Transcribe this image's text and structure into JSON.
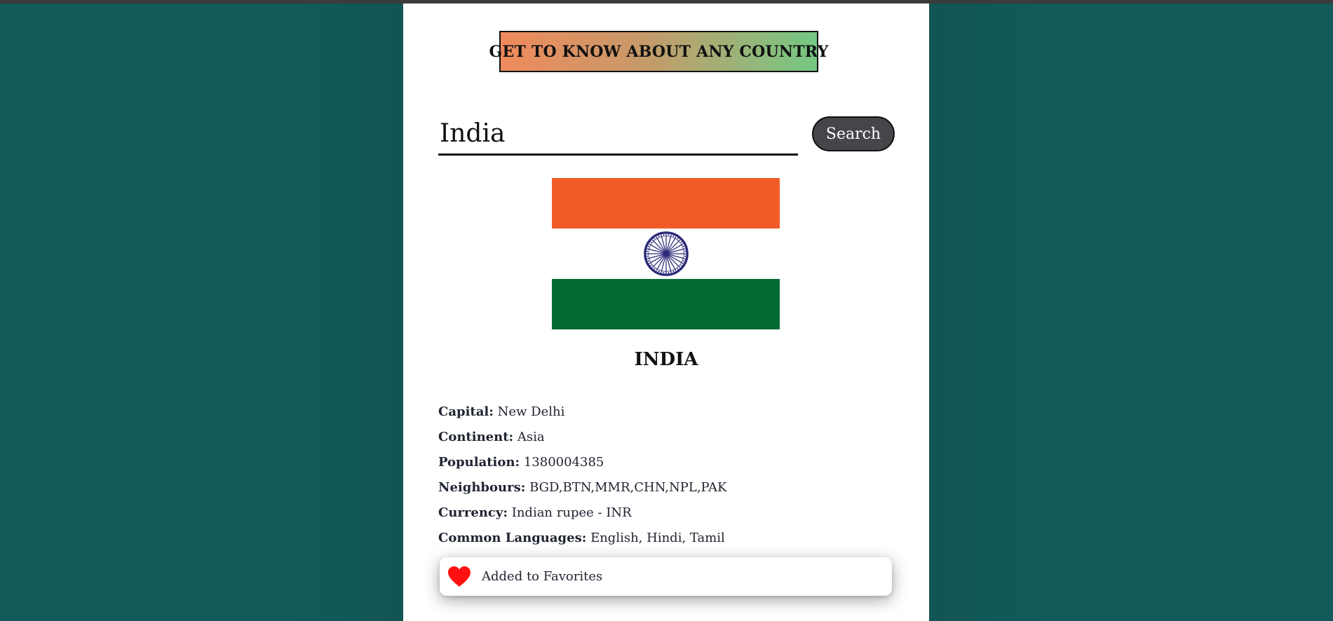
{
  "header": {
    "title": "GET TO KNOW ABOUT ANY COUNTRY"
  },
  "search": {
    "value": "India",
    "button_label": "Search"
  },
  "country": {
    "name": "INDIA",
    "flag_icon": "india-flag",
    "details": [
      {
        "label": "Capital:",
        "value": "New Delhi"
      },
      {
        "label": "Continent:",
        "value": "Asia"
      },
      {
        "label": "Population:",
        "value": "1380004385"
      },
      {
        "label": "Neighbours:",
        "value": "BGD,BTN,MMR,CHN,NPL,PAK"
      },
      {
        "label": "Currency:",
        "value": "Indian rupee - INR"
      },
      {
        "label": "Common Languages:",
        "value": "English, Hindi, Tamil"
      }
    ]
  },
  "toast": {
    "icon": "heart-icon",
    "message": "Added to Favorites"
  },
  "colors": {
    "background": "#135a5a",
    "button": "#464549",
    "saffron": "#f15b27",
    "green": "#036a32",
    "chakra": "#2b2a78",
    "heart": "#ff1111"
  }
}
